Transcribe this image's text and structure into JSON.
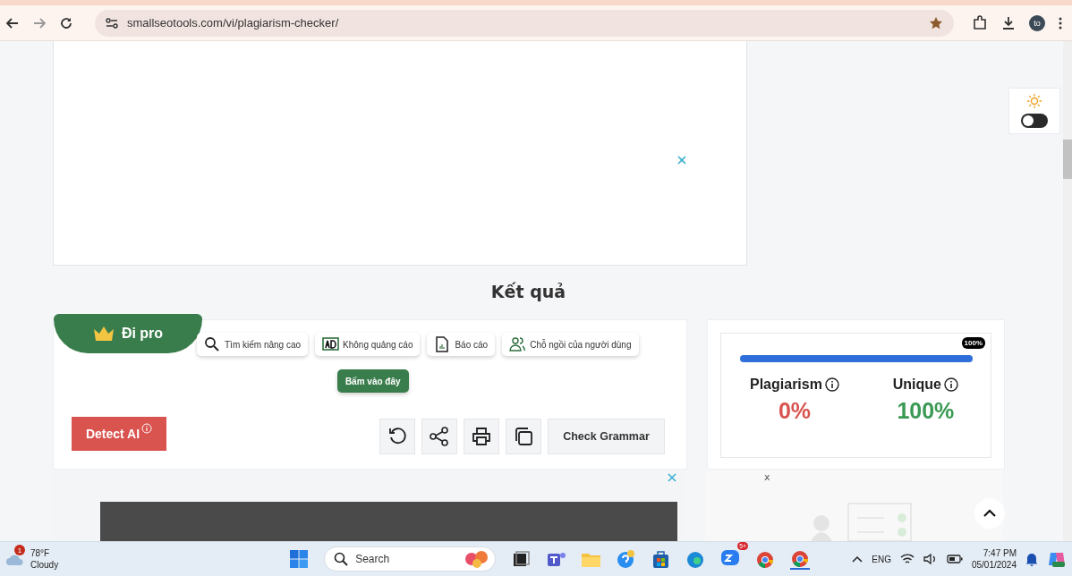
{
  "browser": {
    "url": "smallseotools.com/vi/plagiarism-checker/",
    "profile": "to"
  },
  "theme_toggle": {
    "on": false
  },
  "heading": "Kết quả",
  "pro_ribbon": {
    "label": "Đi pro"
  },
  "features": [
    {
      "kind": "search",
      "label": "Tìm kiếm nâng cao"
    },
    {
      "kind": "ad",
      "label": "Không quảng cáo"
    },
    {
      "kind": "report",
      "label": "Báo cáo"
    },
    {
      "kind": "users",
      "label": "Chỗ ngồi của người dùng"
    }
  ],
  "click_here": "Bấm vào đây",
  "detect_ai": "Detect AI",
  "tools": [
    {
      "kind": "reload"
    },
    {
      "kind": "share"
    },
    {
      "kind": "print"
    },
    {
      "kind": "copy"
    }
  ],
  "check_grammar": "Check Grammar",
  "result": {
    "level": 1,
    "badge": "100%",
    "stats": [
      {
        "label": "Plagiarism",
        "value": "0%",
        "color": "#d9534f"
      },
      {
        "label": "Unique",
        "value": "100%",
        "color": "#3a9a54"
      }
    ]
  },
  "ad_close": "x",
  "taskbar": {
    "weather_badge": "1",
    "temperature": "78°F",
    "condition": "Cloudy",
    "search": "Search",
    "zalo_badge": "5+",
    "language": "ENG",
    "time": "7:47 PM",
    "date": "05/01/2024"
  }
}
